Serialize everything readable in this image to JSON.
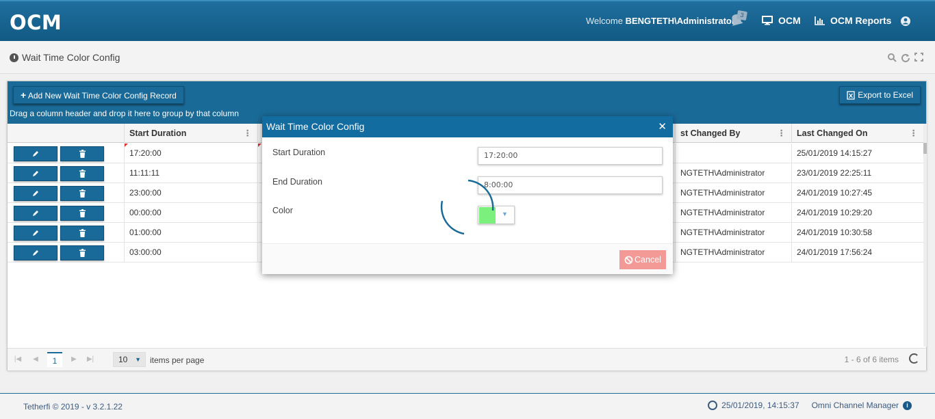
{
  "header": {
    "logo": "OCM",
    "welcome_prefix": "Welcome",
    "username": "BENGTETH\\Administrator",
    "notification_count": "3",
    "nav": [
      {
        "label": "OCM",
        "icon": "monitor-icon"
      },
      {
        "label": "OCM Reports",
        "icon": "bar-chart-icon"
      }
    ],
    "user_icon": "user-circle-icon"
  },
  "page": {
    "title": "Wait Time Color Config",
    "tools": [
      "search-icon",
      "refresh-icon",
      "expand-icon"
    ]
  },
  "grid": {
    "add_label": "Add New Wait Time Color Config Record",
    "export_label": "Export to Excel",
    "group_hint": "Drag a column header and drop it here to group by that column",
    "columns": [
      "Start Duration",
      "st Changed By",
      "Last Changed On"
    ],
    "rows": [
      {
        "start": "17:20:00",
        "changed_by": "",
        "changed_on": "25/01/2019 14:15:27"
      },
      {
        "start": "11:11:11",
        "changed_by": "NGTETH\\Administrator",
        "changed_on": "23/01/2019 22:25:11"
      },
      {
        "start": "23:00:00",
        "changed_by": "NGTETH\\Administrator",
        "changed_on": "24/01/2019 10:27:45"
      },
      {
        "start": "00:00:00",
        "changed_by": "NGTETH\\Administrator",
        "changed_on": "24/01/2019 10:29:20"
      },
      {
        "start": "01:00:00",
        "changed_by": "NGTETH\\Administrator",
        "changed_on": "24/01/2019 10:30:58"
      },
      {
        "start": "03:00:00",
        "changed_by": "NGTETH\\Administrator",
        "changed_on": "24/01/2019 17:56:24"
      }
    ],
    "pager": {
      "current_page": "1",
      "page_size": "10",
      "items_per_page_label": "items per page",
      "info": "1 - 6 of 6 items"
    }
  },
  "dialog": {
    "title": "Wait Time Color Config",
    "close_glyph": "✕",
    "fields": {
      "start_label": "Start Duration",
      "start_value": "17:20:00",
      "end_label": "End Duration",
      "end_value": "8:00:00",
      "color_label": "Color",
      "color_value": "#7cf07c"
    },
    "cancel_label": "Cancel"
  },
  "footer": {
    "copyright": "Tetherfi © 2019 - v 3.2.1.22",
    "datetime": "25/01/2019, 14:15:37",
    "app_name": "Omni Channel Manager"
  },
  "colors": {
    "brand": "#136ca0",
    "cancel": "#f39a97",
    "dirty_marker": "#dd3333"
  }
}
